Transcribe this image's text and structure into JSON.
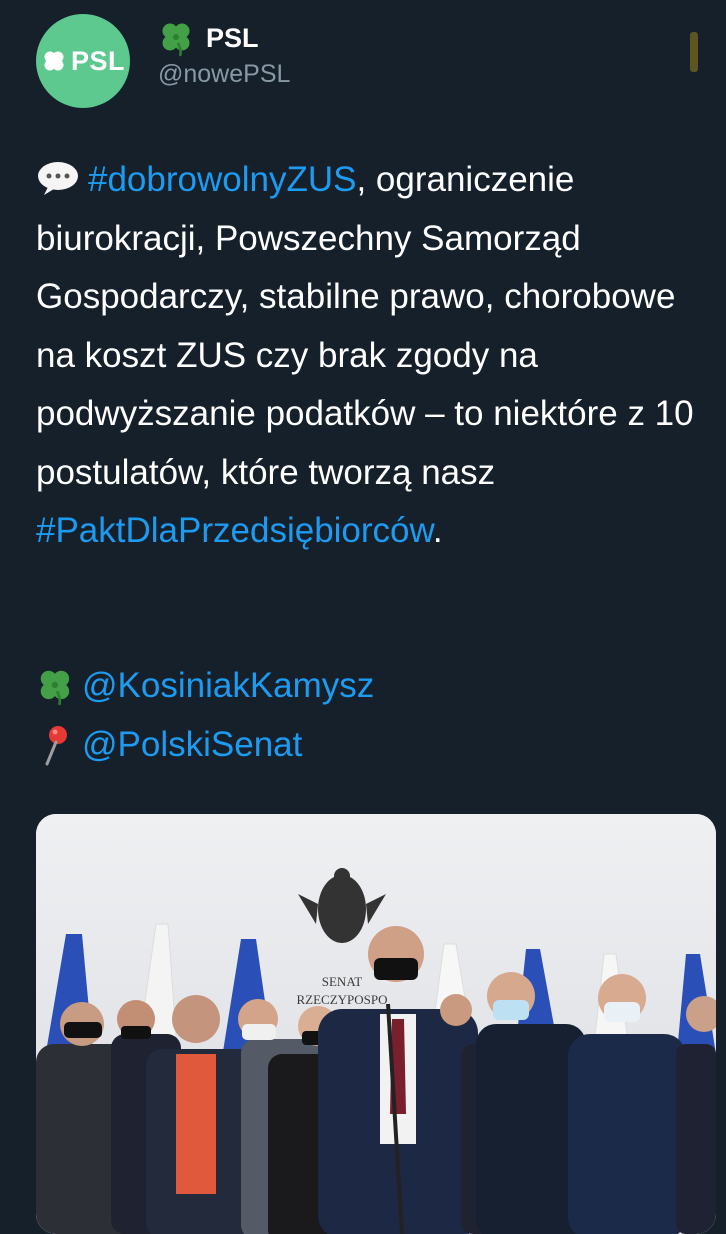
{
  "account": {
    "avatar_text": "PSL",
    "name": "PSL",
    "handle": "@nowePSL"
  },
  "tweet": {
    "hashtag_zus": "#dobrowolnyZUS",
    "text_main": ", ograniczenie biurokracji, Powszechny Samorząd Gospodarczy, stabilne prawo, chorobowe na koszt ZUS czy brak zgody na podwyższanie podatków – to niektóre z 10 postulatów, które tworzą nasz ",
    "hashtag_pakt": "#PaktDlaPrzedsiębiorców",
    "text_end": ".",
    "mention_1": "@KosiniakKamysz",
    "mention_2": "@PolskiSenat"
  },
  "photo": {
    "sign_line_1": "SENAT",
    "sign_line_2": "RZECZYPOSPO"
  },
  "colors": {
    "background": "#15202b",
    "link": "#1d9bf0",
    "secondary_text": "#8899a6",
    "avatar_bg": "#5ec98f"
  }
}
